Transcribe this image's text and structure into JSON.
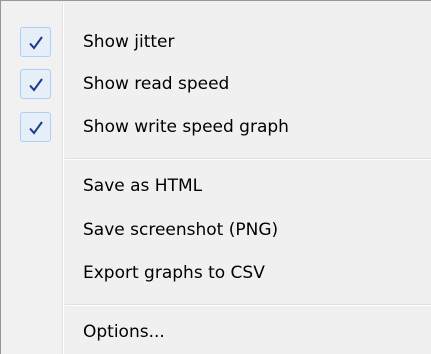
{
  "menu": {
    "items": [
      {
        "label": "Show jitter",
        "checked": true
      },
      {
        "label": "Show read speed",
        "checked": true
      },
      {
        "label": "Show write speed graph",
        "checked": true
      },
      {
        "label": "Save as HTML",
        "checked": false
      },
      {
        "label": "Save screenshot (PNG)",
        "checked": false
      },
      {
        "label": "Export graphs to CSV",
        "checked": false
      },
      {
        "label": "Options...",
        "checked": false
      }
    ]
  },
  "colors": {
    "menu_background": "#f0f0f0",
    "check_background": "#e6eff8",
    "check_border": "#aecff7",
    "check_mark": "#1e3a8a"
  }
}
